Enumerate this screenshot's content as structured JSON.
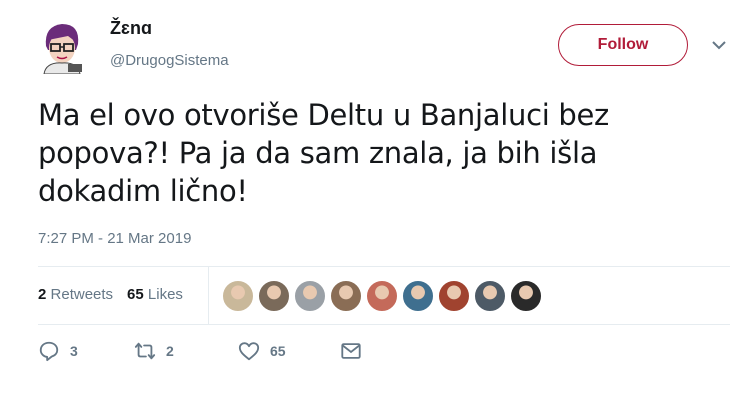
{
  "user": {
    "display_name": "Žɛnɑ",
    "handle": "@DrugogSistema"
  },
  "follow_label": "Follow",
  "tweet": {
    "lines": [
      "Ma el ovo otvoriše Deltu u Banjaluci bez",
      "popova?! Pa ja da sam znala, ja bih išla",
      "dokadim lično!"
    ],
    "timestamp": "7:27 PM - 21 Mar 2019"
  },
  "stats": {
    "retweets_count": "2",
    "retweets_label": "Retweets",
    "likes_count": "65",
    "likes_label": "Likes"
  },
  "liker_avatars": [
    {
      "color": "#c9b89a"
    },
    {
      "color": "#7a6a5a"
    },
    {
      "color": "#9aa0a6"
    },
    {
      "color": "#8a6d55"
    },
    {
      "color": "#c46a5a"
    },
    {
      "color": "#3f6f8f"
    },
    {
      "color": "#a0432f"
    },
    {
      "color": "#4d5a66"
    },
    {
      "color": "#2a2a2a"
    }
  ],
  "actions": {
    "reply_count": "3",
    "retweet_count": "2",
    "like_count": "65"
  },
  "colors": {
    "follow_accent": "#b11c39",
    "secondary_text": "#657786"
  }
}
